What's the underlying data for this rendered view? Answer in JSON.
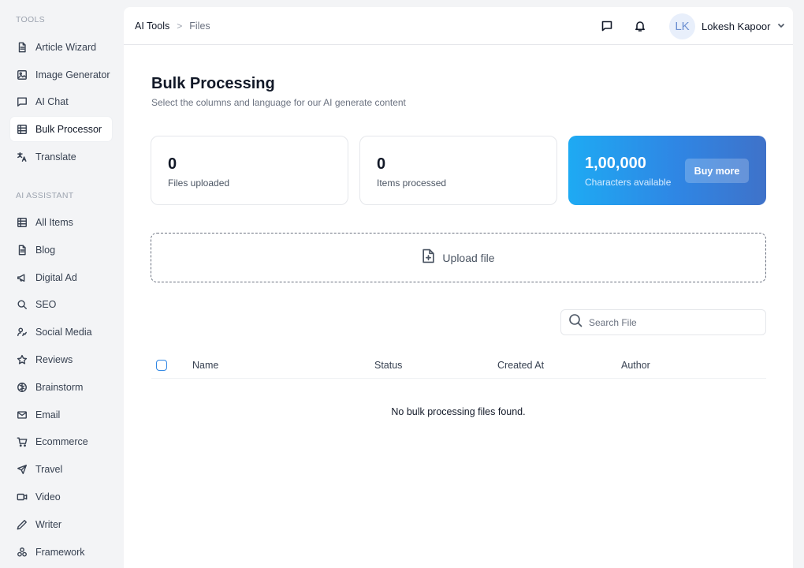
{
  "sidebar": {
    "tools_title": "TOOLS",
    "tools": [
      {
        "label": "Article Wizard",
        "icon": "document-icon"
      },
      {
        "label": "Image Generator",
        "icon": "image-icon"
      },
      {
        "label": "AI Chat",
        "icon": "chat-icon"
      },
      {
        "label": "Bulk Processor",
        "icon": "table-icon",
        "active": true
      },
      {
        "label": "Translate",
        "icon": "translate-icon"
      }
    ],
    "assistant_title": "AI ASSISTANT",
    "assistant": [
      {
        "label": "All Items",
        "icon": "table-icon"
      },
      {
        "label": "Blog",
        "icon": "document-icon"
      },
      {
        "label": "Digital Ad",
        "icon": "megaphone-icon"
      },
      {
        "label": "SEO",
        "icon": "search-icon"
      },
      {
        "label": "Social Media",
        "icon": "people-icon"
      },
      {
        "label": "Reviews",
        "icon": "star-icon"
      },
      {
        "label": "Brainstorm",
        "icon": "brain-icon"
      },
      {
        "label": "Email",
        "icon": "mail-icon"
      },
      {
        "label": "Ecommerce",
        "icon": "cart-icon"
      },
      {
        "label": "Travel",
        "icon": "plane-icon"
      },
      {
        "label": "Video",
        "icon": "video-icon"
      },
      {
        "label": "Writer",
        "icon": "pen-icon"
      },
      {
        "label": "Framework",
        "icon": "framework-icon"
      }
    ]
  },
  "header": {
    "breadcrumb_root": "AI Tools",
    "breadcrumb_sep": ">",
    "breadcrumb_current": "Files",
    "user_initials": "LK",
    "user_name": "Lokesh Kapoor"
  },
  "page": {
    "title": "Bulk Processing",
    "subtitle": "Select the columns and language for our AI generate content"
  },
  "stats": {
    "files_uploaded": {
      "value": "0",
      "label": "Files uploaded"
    },
    "items_processed": {
      "value": "0",
      "label": "Items processed"
    },
    "characters": {
      "value": "1,00,000",
      "label": "Characters available",
      "button": "Buy more"
    }
  },
  "upload": {
    "label": "Upload file"
  },
  "search": {
    "placeholder": "Search File"
  },
  "table": {
    "columns": [
      "Name",
      "Status",
      "Created At",
      "Author"
    ],
    "empty_message": "No bulk processing files found."
  },
  "colors": {
    "accent": "#2f86e4",
    "gradient_start": "#1eaaf3",
    "gradient_end": "#3f72c9"
  }
}
